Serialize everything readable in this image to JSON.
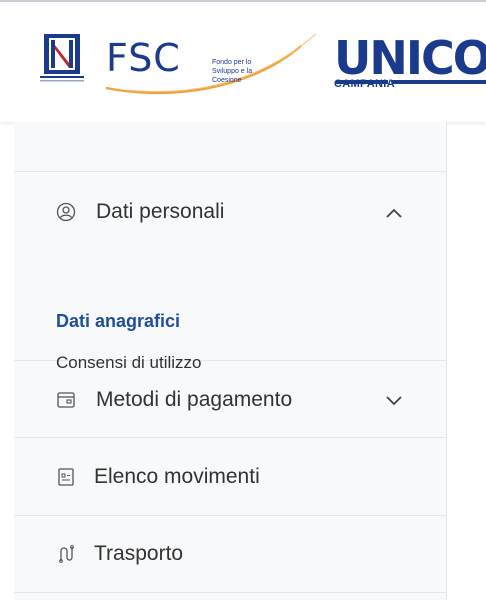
{
  "header": {
    "fsc_logo": "FSC",
    "fsc_tagline": "Fondo per lo Sviluppo e la Coesione",
    "unico_logo": "UNICO",
    "unico_subtitle": "CAMPANIA"
  },
  "sidebar": {
    "items": [
      {
        "label": "Dati personali",
        "icon": "user-circle-icon",
        "expanded": true,
        "children": [
          {
            "label": "Dati anagrafici",
            "active": true
          },
          {
            "label": "Consensi di utilizzo",
            "active": false
          }
        ]
      },
      {
        "label": "Metodi di pagamento",
        "icon": "wallet-icon",
        "expanded": false
      },
      {
        "label": "Elenco movimenti",
        "icon": "receipt-icon"
      },
      {
        "label": "Trasporto",
        "icon": "route-icon"
      }
    ]
  },
  "colors": {
    "active_link": "#1f4f9a",
    "text": "#333333",
    "sidebar_bg": "#f8f9fa",
    "divider": "#e4e6ea",
    "brand_blue": "#1a3a8c",
    "brand_green": "#3fb13f",
    "brand_orange": "#f2a13a"
  }
}
